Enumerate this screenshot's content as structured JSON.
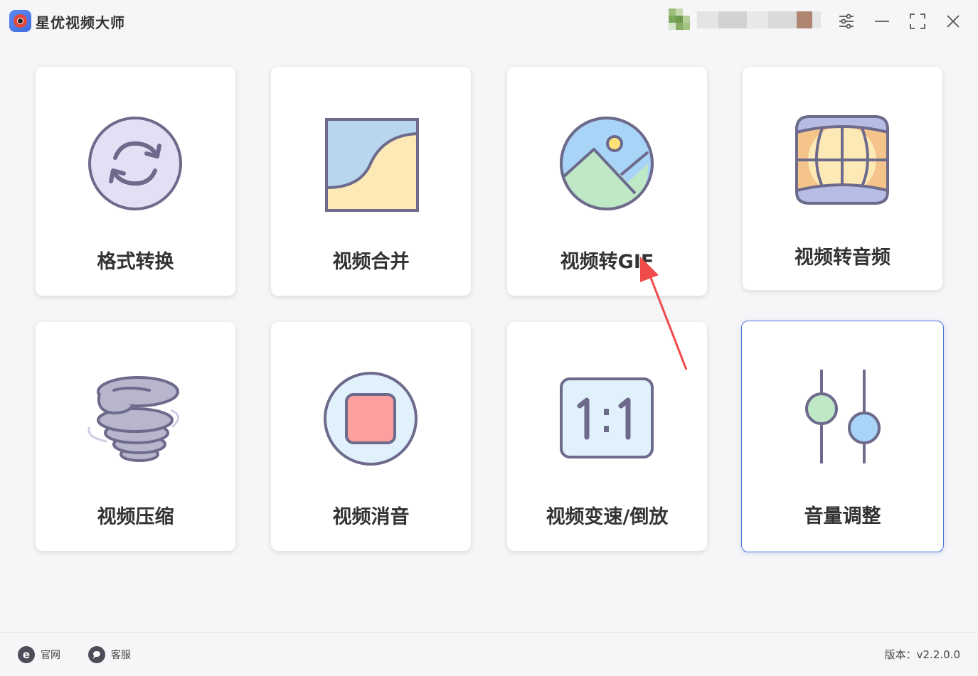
{
  "app": {
    "title": "星优视频大师"
  },
  "cards": [
    {
      "label": "格式转换",
      "icon": "format-convert-icon"
    },
    {
      "label": "视频合并",
      "icon": "video-merge-icon"
    },
    {
      "label": "视频转GIF",
      "icon": "gif-image-icon"
    },
    {
      "label": "视频转音频",
      "icon": "audio-globe-icon"
    },
    {
      "label": "视频压缩",
      "icon": "tornado-icon"
    },
    {
      "label": "视频消音",
      "icon": "stop-icon"
    },
    {
      "label": "视频变速/倒放",
      "icon": "ratio-icon"
    },
    {
      "label": "音量调整",
      "icon": "sliders-icon"
    }
  ],
  "footer": {
    "website_label": "官网",
    "support_label": "客服",
    "version": "版本：v2.2.0.0"
  },
  "colors": {
    "accent": "#4b77d8",
    "icon_stroke": "#6d6a8c",
    "arrow": "#f04a4a"
  }
}
